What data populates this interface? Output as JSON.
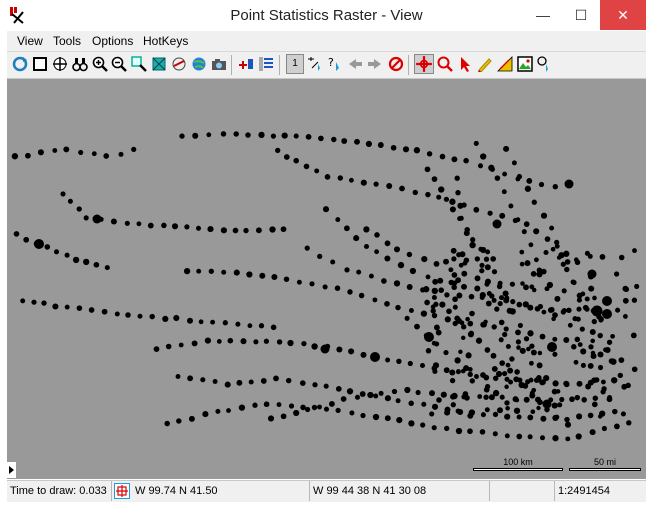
{
  "window": {
    "title": "Point Statistics Raster - View",
    "minimize_glyph": "—",
    "maximize_glyph": "☐",
    "close_glyph": "✕"
  },
  "menu": {
    "items": [
      "View",
      "Tools",
      "Options",
      "HotKeys"
    ]
  },
  "toolbar": {
    "icons": [
      "redraw-icon",
      "full-view-icon",
      "pan-icon",
      "binoculars-icon",
      "zoom-in-icon",
      "zoom-out-icon",
      "zoom-box-icon",
      "zoom-layer-icon",
      "map-scale-icon",
      "georef-icon",
      "snapshot-icon",
      "add-layer-icon",
      "layer-manager-icon",
      "single-select-icon",
      "multi-select-icon",
      "query-icon",
      "previous-icon",
      "next-icon",
      "no-select-icon",
      "move-icon",
      "zoom-select-icon",
      "pointer-icon",
      "pen-icon",
      "measure-icon",
      "image-icon",
      "lasso-icon"
    ],
    "page_indicator": "1"
  },
  "scalebar": {
    "km_label": "100 km",
    "mi_label": "50 mi"
  },
  "status": {
    "time_to_draw": "Time to draw: 0.033",
    "cursor_decimal": "W 99.74  N 41.50",
    "cursor_dms": "W 99 44 38  N 41 30 08",
    "scale": "1:2491454"
  },
  "colors": {
    "map_background": "#999999",
    "points": "#000000",
    "close_button": "#e04343"
  }
}
